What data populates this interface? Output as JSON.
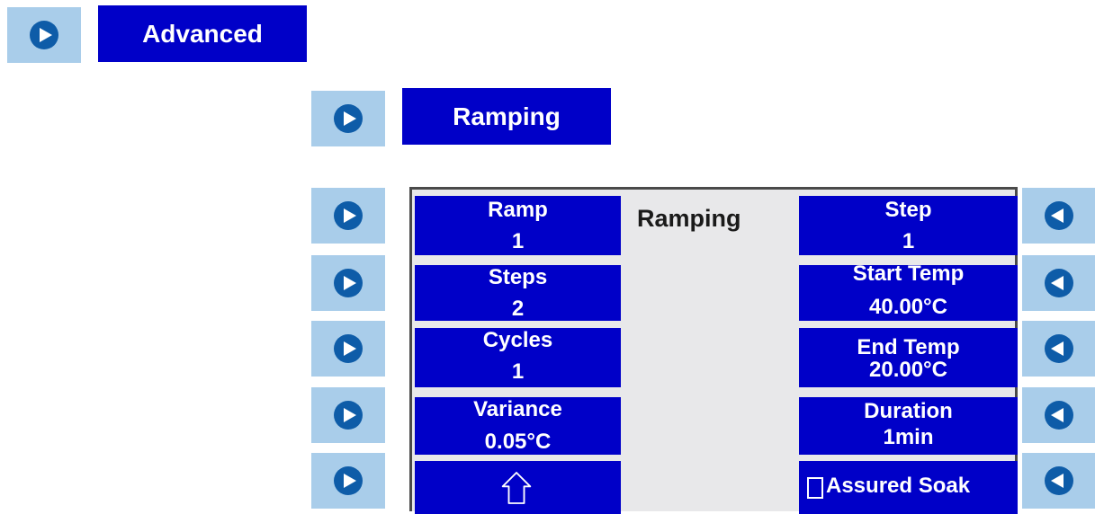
{
  "top_button": {
    "label": "Advanced"
  },
  "sub_button": {
    "label": "Ramping"
  },
  "screen": {
    "title": "Ramping",
    "left": [
      {
        "label": "Ramp",
        "value": "1"
      },
      {
        "label": "Steps",
        "value": "2"
      },
      {
        "label": "Cycles",
        "value": "1"
      },
      {
        "label": "Variance",
        "value": "0.05°C"
      }
    ],
    "right": [
      {
        "label": "Step",
        "value": "1"
      },
      {
        "label": "Start Temp",
        "value": "40.00°C"
      },
      {
        "label": "End Temp",
        "value": "20.00°C"
      },
      {
        "label": "Duration",
        "value": "1min"
      }
    ],
    "home_icon": "home-arrow-up-icon",
    "assured_soak": {
      "label": "Assured Soak",
      "checked": false
    }
  },
  "colors": {
    "button_blue": "#0000c8",
    "arrow_tile": "#a9cdea",
    "arrow_dark": "#0e5ca8",
    "screen_bg": "#e8e8ea"
  }
}
